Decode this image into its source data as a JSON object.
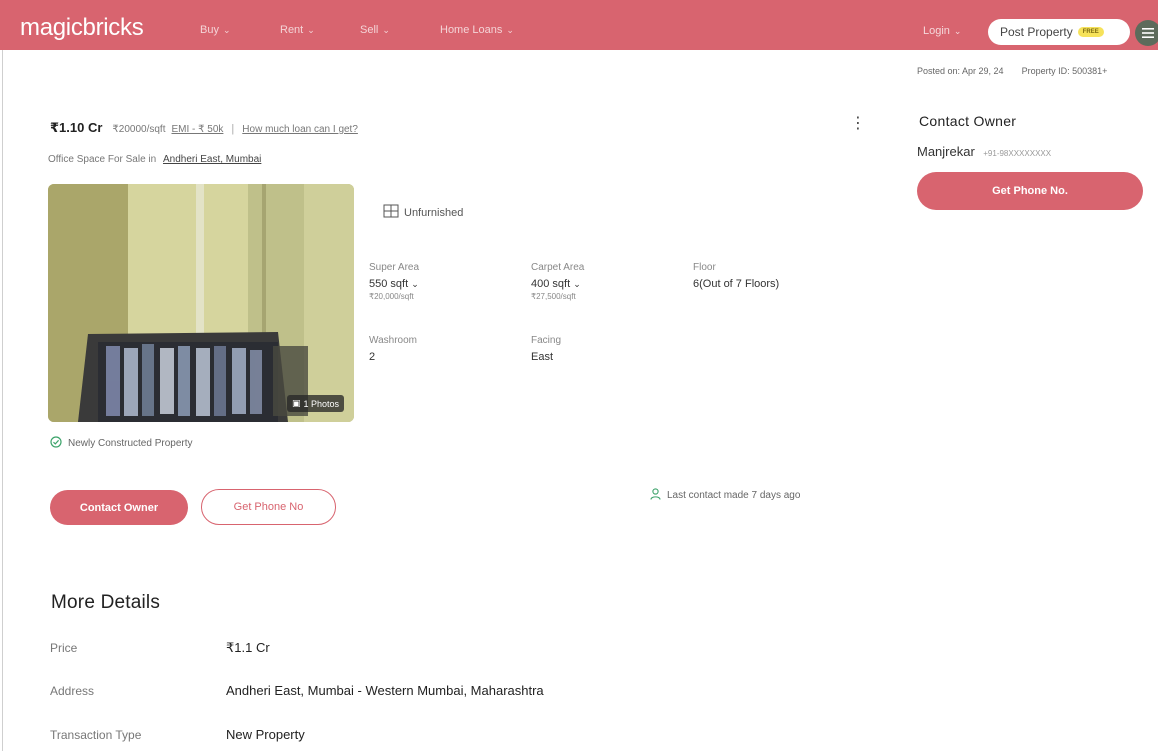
{
  "header": {
    "logo": "magicbricks",
    "nav": [
      {
        "label": "Buy"
      },
      {
        "label": "Rent"
      },
      {
        "label": "Sell"
      },
      {
        "label": "Home Loans"
      }
    ],
    "login_label": "Login",
    "post_property_label": "Post Property",
    "post_property_badge": "FREE",
    "menu_icon": "hamburger-icon"
  },
  "meta": {
    "posted_on": "Posted on: Apr 29, 24",
    "property_id": "Property ID: 500381+"
  },
  "listing": {
    "price": "₹1.10 Cr",
    "rate": "₹20000/sqft",
    "emi": "EMI - ₹ 50k",
    "loan_link": "How much loan can I get?",
    "subtitle_prefix": "Office Space For Sale in",
    "location_link": "Andheri East, Mumbai",
    "photos_badge": "1 Photos",
    "furnishing": "Unfurnished",
    "specs": {
      "super_area": {
        "label": "Super Area",
        "value": "550 sqft",
        "sub": "₹20,000/sqft"
      },
      "carpet_area": {
        "label": "Carpet Area",
        "value": "400 sqft",
        "sub": "₹27,500/sqft"
      },
      "floor": {
        "label": "Floor",
        "value": "6(Out of 7 Floors)"
      },
      "washroom": {
        "label": "Washroom",
        "value": "2"
      },
      "facing": {
        "label": "Facing",
        "value": "East"
      }
    },
    "newly_constructed": "Newly Constructed Property",
    "contact_owner_btn": "Contact Owner",
    "get_phone_btn": "Get Phone No",
    "last_contact": "Last contact made 7 days ago"
  },
  "sidebar": {
    "title": "Contact Owner",
    "owner_name": "Manjrekar",
    "owner_phone": "+91-98XXXXXXXX",
    "get_phone_btn": "Get Phone No."
  },
  "more_details": {
    "title": "More Details",
    "rows": [
      {
        "key": "Price",
        "value": "₹1.1 Cr"
      },
      {
        "key": "Address",
        "value": "Andheri East, Mumbai - Western Mumbai, Maharashtra"
      },
      {
        "key": "Transaction Type",
        "value": "New Property"
      }
    ]
  },
  "colors": {
    "brand": "#d8646f",
    "badge": "#f6e25a",
    "success": "#3ca36a"
  }
}
